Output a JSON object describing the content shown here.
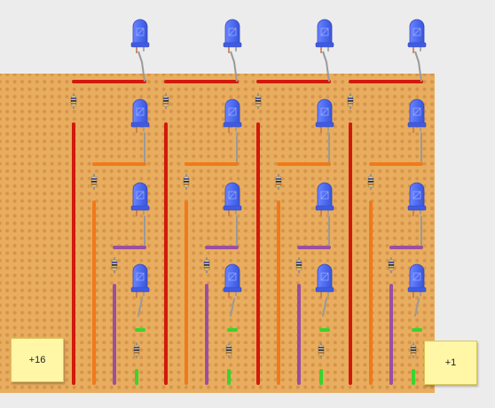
{
  "board": {
    "color": "#e8ad5f",
    "hole_color": "#d5944a",
    "columns": 4
  },
  "wire_colors": {
    "red": "#d11a0c",
    "orange": "#f07a1a",
    "purple": "#9a4fa0",
    "green": "#39d42c",
    "leg": "#9a9a9a"
  },
  "led_color": "#4f6df2",
  "labels": {
    "left": "+16",
    "right": "+1"
  }
}
